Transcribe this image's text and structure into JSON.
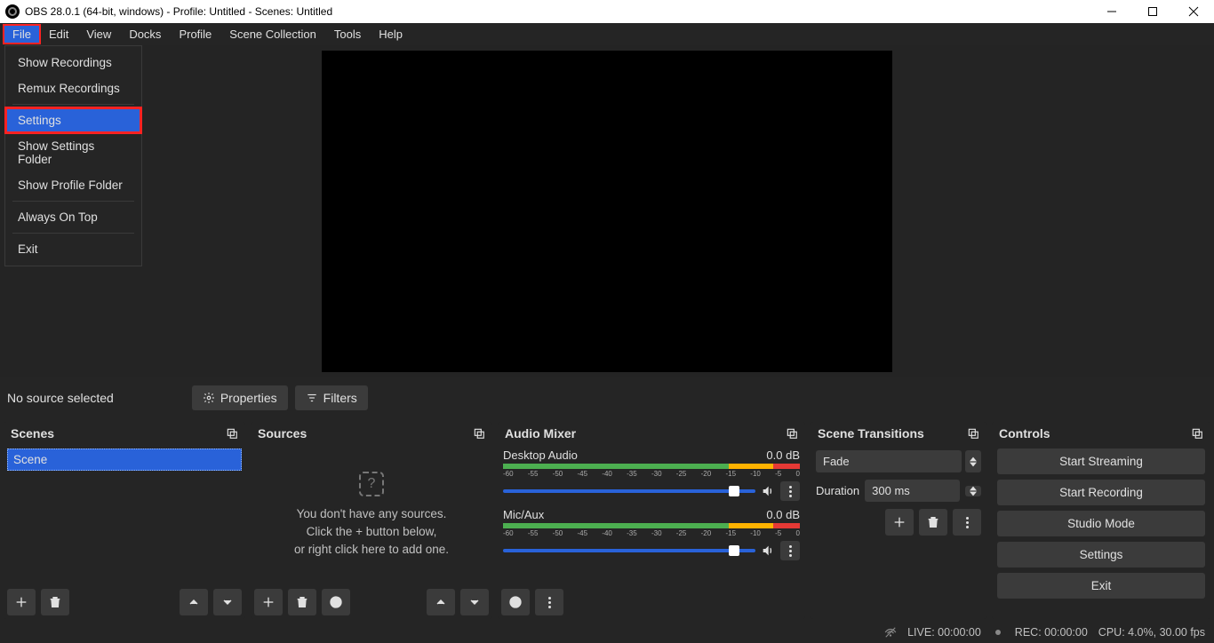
{
  "titlebar": {
    "text": "OBS 28.0.1 (64-bit, windows) - Profile: Untitled - Scenes: Untitled"
  },
  "menubar": {
    "items": [
      "File",
      "Edit",
      "View",
      "Docks",
      "Profile",
      "Scene Collection",
      "Tools",
      "Help"
    ]
  },
  "file_menu": {
    "show_recordings": "Show Recordings",
    "remux_recordings": "Remux Recordings",
    "settings": "Settings",
    "show_settings_folder": "Show Settings Folder",
    "show_profile_folder": "Show Profile Folder",
    "always_on_top": "Always On Top",
    "exit": "Exit"
  },
  "toolbar": {
    "no_source": "No source selected",
    "properties": "Properties",
    "filters": "Filters"
  },
  "panels": {
    "scenes": {
      "title": "Scenes",
      "item": "Scene"
    },
    "sources": {
      "title": "Sources",
      "line1": "You don't have any sources.",
      "line2": "Click the + button below,",
      "line3": "or right click here to add one."
    },
    "audio": {
      "title": "Audio Mixer",
      "tracks": [
        {
          "name": "Desktop Audio",
          "db": "0.0 dB"
        },
        {
          "name": "Mic/Aux",
          "db": "0.0 dB"
        }
      ],
      "ticks": [
        "-60",
        "-55",
        "-50",
        "-45",
        "-40",
        "-35",
        "-30",
        "-25",
        "-20",
        "-15",
        "-10",
        "-5",
        "0"
      ]
    },
    "transitions": {
      "title": "Scene Transitions",
      "current": "Fade",
      "duration_label": "Duration",
      "duration_value": "300 ms"
    },
    "controls": {
      "title": "Controls",
      "start_streaming": "Start Streaming",
      "start_recording": "Start Recording",
      "studio_mode": "Studio Mode",
      "settings": "Settings",
      "exit": "Exit"
    }
  },
  "statusbar": {
    "live": "LIVE: 00:00:00",
    "rec": "REC: 00:00:00",
    "cpu": "CPU: 4.0%, 30.00 fps"
  }
}
